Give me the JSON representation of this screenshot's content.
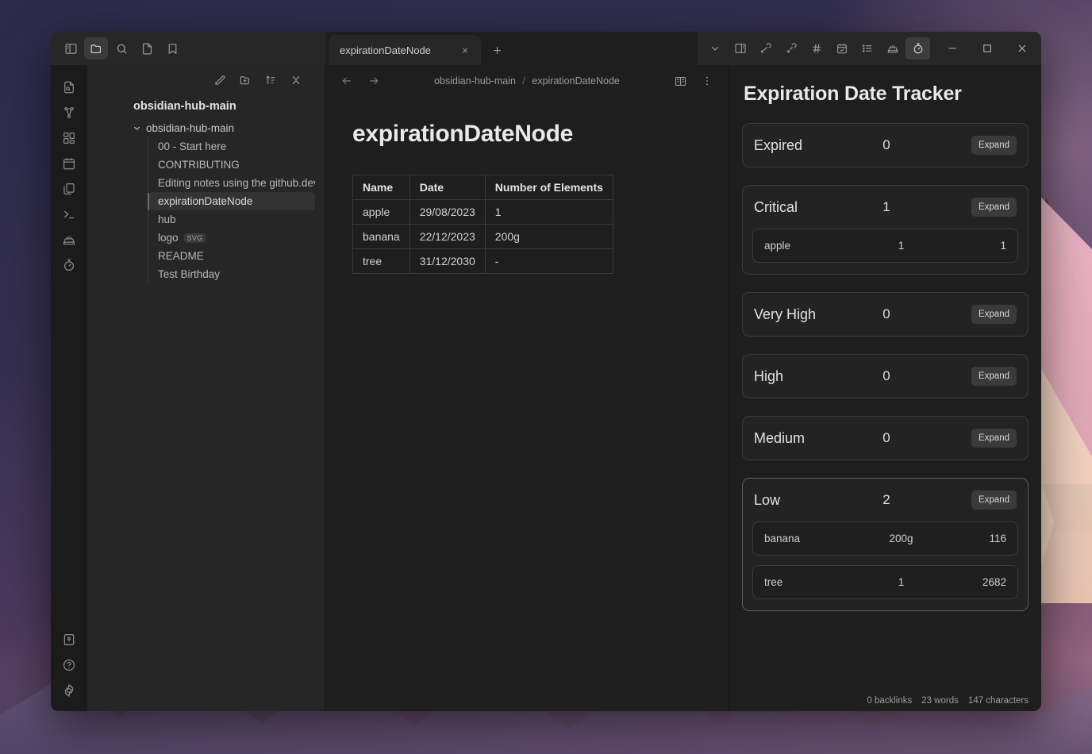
{
  "titlebar": {
    "left_icons": [
      {
        "name": "toggle-left-sidebar-icon",
        "active": false
      },
      {
        "name": "folder-icon",
        "active": true
      },
      {
        "name": "search-icon",
        "active": false
      },
      {
        "name": "file-icon",
        "active": false
      },
      {
        "name": "bookmark-icon",
        "active": false
      }
    ],
    "tab": {
      "label": "expirationDateNode",
      "close_label": "×",
      "new_tab_label": "+"
    },
    "plugin_icons": [
      {
        "name": "chevron-down-icon",
        "active": false
      },
      {
        "name": "toggle-right-sidebar-icon",
        "active": false
      },
      {
        "name": "link-incoming-icon",
        "active": false
      },
      {
        "name": "link-outgoing-icon",
        "active": false
      },
      {
        "name": "hash-icon",
        "active": false
      },
      {
        "name": "calendar-check-icon",
        "active": false
      },
      {
        "name": "list-icon",
        "active": false
      },
      {
        "name": "birthday-cake-icon",
        "active": false
      },
      {
        "name": "timer-icon",
        "active": true
      }
    ],
    "window_controls": {
      "minimize": "─",
      "maximize": "□",
      "close": "✕"
    }
  },
  "ribbon": {
    "top_icons": [
      "file-search-icon",
      "graph-view-icon",
      "canvas-icon",
      "calendar-icon",
      "copy-files-icon",
      "terminal-icon",
      "birthday-cake-icon",
      "timer-icon"
    ],
    "bottom_icons": [
      "vault-switcher-icon",
      "help-icon",
      "settings-gear-icon"
    ]
  },
  "explorer": {
    "nav_icons": [
      "new-note-icon",
      "new-folder-icon",
      "sort-order-icon",
      "collapse-all-icon"
    ],
    "vault_title": "obsidian-hub-main",
    "root_folder": {
      "label": "obsidian-hub-main",
      "expanded": true
    },
    "files": [
      {
        "label": "00 - Start here",
        "selected": false,
        "ext": null
      },
      {
        "label": "CONTRIBUTING",
        "selected": false,
        "ext": null
      },
      {
        "label": "Editing notes using the github.dev ed…",
        "selected": false,
        "ext": null
      },
      {
        "label": "expirationDateNode",
        "selected": true,
        "ext": null
      },
      {
        "label": "hub",
        "selected": false,
        "ext": null
      },
      {
        "label": "logo",
        "selected": false,
        "ext": "SVG"
      },
      {
        "label": "README",
        "selected": false,
        "ext": null
      },
      {
        "label": "Test Birthday",
        "selected": false,
        "ext": null
      }
    ]
  },
  "editor": {
    "back_icon": "arrow-left-icon",
    "forward_icon": "arrow-right-icon",
    "breadcrumb": {
      "root": "obsidian-hub-main",
      "separator": "/",
      "leaf": "expirationDateNode"
    },
    "reading_view_icon": "book-open-icon",
    "more_options_icon": "more-vertical-icon",
    "title": "expirationDateNode",
    "table": {
      "headers": [
        "Name",
        "Date",
        "Number of Elements"
      ],
      "rows": [
        [
          "apple",
          "29/08/2023",
          "1"
        ],
        [
          "banana",
          "22/12/2023",
          "200g"
        ],
        [
          "tree",
          "31/12/2030",
          "-"
        ]
      ]
    }
  },
  "tracker": {
    "title": "Expiration Date Tracker",
    "expand_label": "Expand",
    "groups": [
      {
        "label": "Expired",
        "count": "0",
        "highlight": false,
        "items": []
      },
      {
        "label": "Critical",
        "count": "1",
        "highlight": false,
        "items": [
          {
            "name": "apple",
            "middle": "1",
            "right": "1"
          }
        ]
      },
      {
        "label": "Very High",
        "count": "0",
        "highlight": false,
        "items": []
      },
      {
        "label": "High",
        "count": "0",
        "highlight": false,
        "items": []
      },
      {
        "label": "Medium",
        "count": "0",
        "highlight": false,
        "items": []
      },
      {
        "label": "Low",
        "count": "2",
        "highlight": true,
        "items": [
          {
            "name": "banana",
            "middle": "200g",
            "right": "116"
          },
          {
            "name": "tree",
            "middle": "1",
            "right": "2682"
          }
        ]
      }
    ]
  },
  "statusbar": {
    "backlinks": "0 backlinks",
    "words": "23 words",
    "characters": "147 characters"
  },
  "colors": {
    "window_bg": "#1e1e1e",
    "titlebar_bg": "#272727",
    "explorer_bg": "#262626",
    "card_bg": "#232323",
    "card_border": "#3b3b3b",
    "accent_text": "#e9e9e9"
  }
}
